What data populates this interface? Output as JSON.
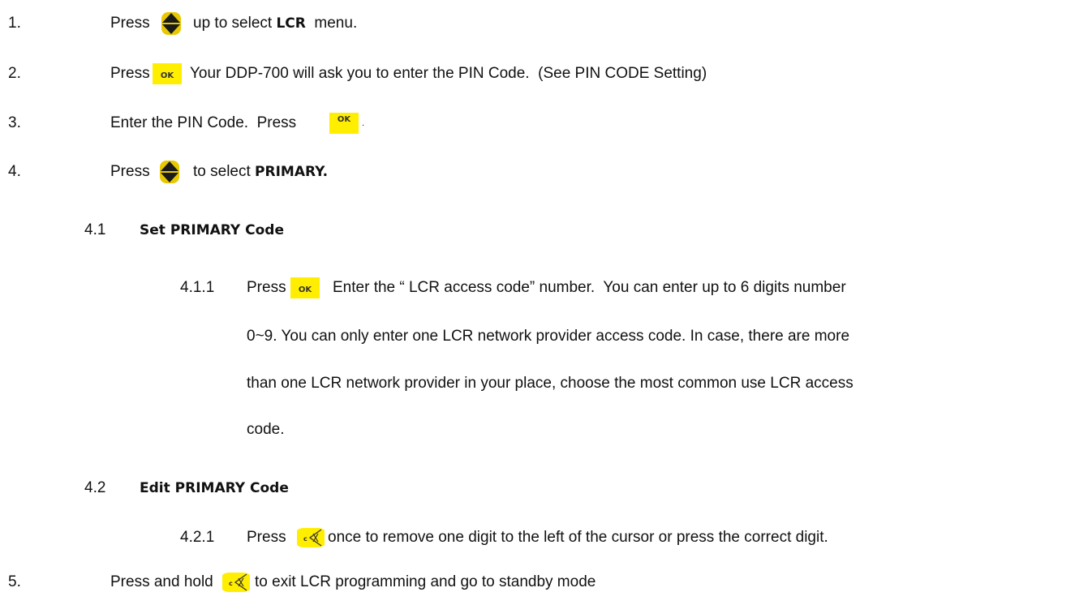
{
  "steps": [
    {
      "num": "1.",
      "press": "Press",
      "after": "up to select ",
      "bold": "LCR",
      "tail": "  menu."
    },
    {
      "num": "2.",
      "press": "Press",
      "key": "OK",
      "after": "Your DDP-700 will ask you to enter the PIN Code.  (See PIN CODE Setting)"
    },
    {
      "num": "3.",
      "text": "Enter the PIN Code.  Press",
      "key": "OK",
      "tail": "."
    },
    {
      "num": "4.",
      "press": "Press",
      "after": "to select ",
      "bold": "PRIMARY."
    }
  ],
  "sub_41": {
    "num": "4.1",
    "title": "Set PRIMARY Code"
  },
  "step_411": {
    "num": "4.1.1",
    "press": "Press",
    "key": "OK",
    "line1": "Enter the “ LCR access code” number.  You can enter up to 6 digits number",
    "line2": "0~9.  You can only enter one LCR network provider access code.  In case, there are more",
    "line3": "than one LCR network provider in your place, choose the most common use LCR access",
    "line4": "code."
  },
  "sub_42": {
    "num": "4.2",
    "title": "Edit PRIMARY Code"
  },
  "step_421": {
    "num": "4.2.1",
    "press": "Press",
    "after": "once to remove one digit to the left of the cursor or press the correct digit."
  },
  "step_5": {
    "num": "5.",
    "text": "Press and hold",
    "after": "to exit LCR programming and go to standby mode"
  },
  "icons": {
    "arrow": "up-down-arrow-icon",
    "ok": "ok-key-icon",
    "clear": "clear-back-key-icon"
  },
  "colors": {
    "key_yellow": "#ffee00",
    "arrow_gold": "#e8c800",
    "arrow_dark": "#1a1a1a"
  }
}
